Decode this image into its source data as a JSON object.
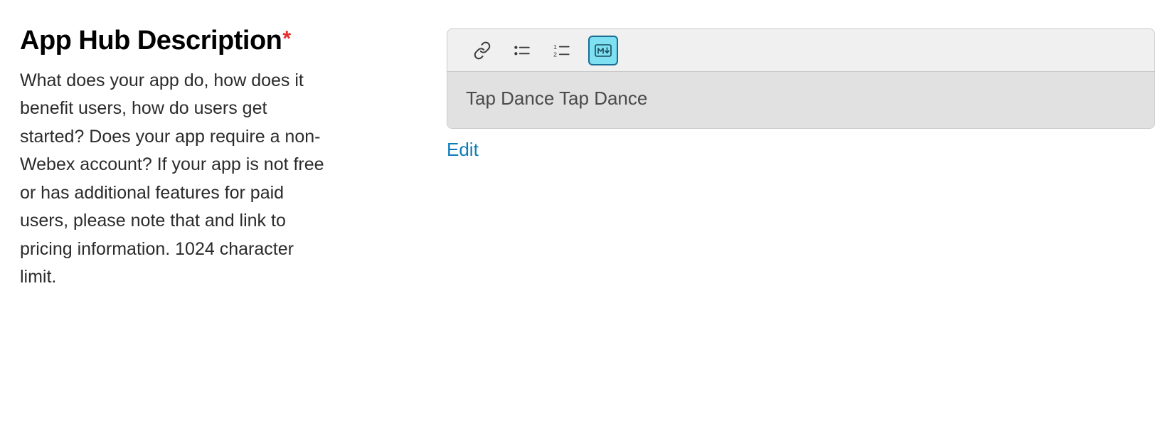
{
  "field": {
    "label": "App Hub Description",
    "required_marker": "*",
    "help_text": "What does your app do, how does it benefit users, how do users get started? Does your app require a non-Webex account? If your app is not free or has additional features for paid users, please note that and link to pricing information. 1024 character limit."
  },
  "editor": {
    "content": "Tap Dance Tap Dance",
    "edit_link": "Edit"
  }
}
